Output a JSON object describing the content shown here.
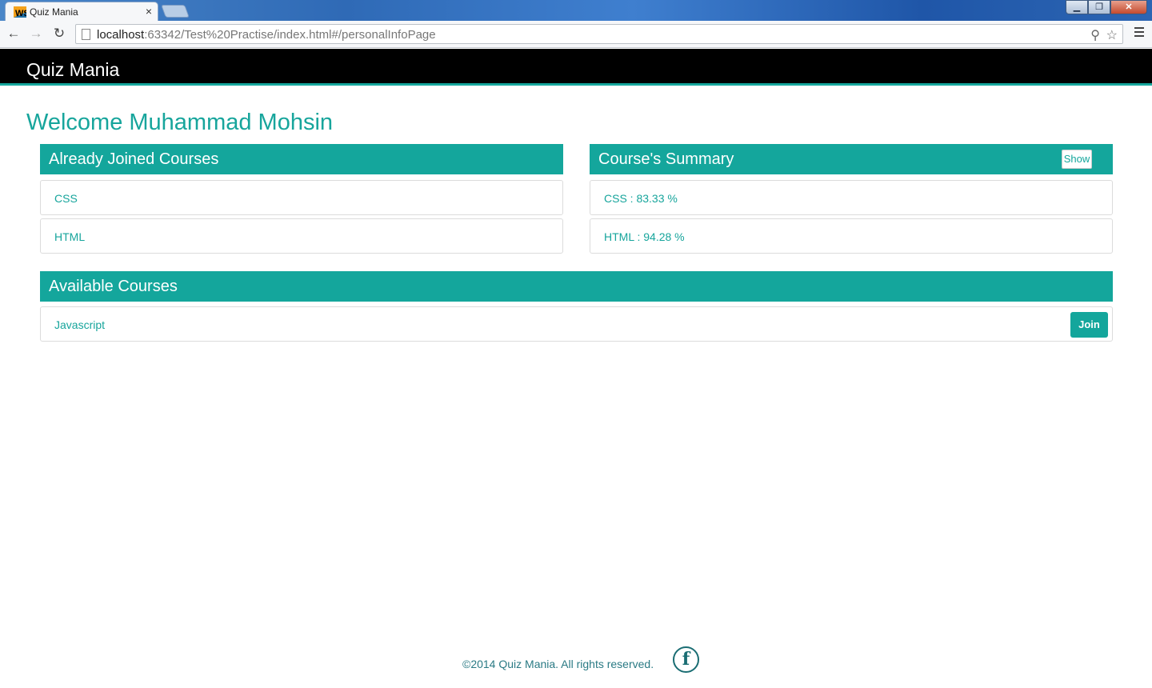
{
  "browser": {
    "tab_title": "Quiz Mania",
    "tab_close": "×",
    "url_host": "localhost",
    "url_rest": ":63342/Test%20Practise/index.html#/personalInfoPage",
    "window_buttons": [
      "▁",
      "❐",
      "✕"
    ]
  },
  "navbar": {
    "brand": "Quiz Mania"
  },
  "welcome": "Welcome Muhammad Mohsin",
  "joined": {
    "title": "Already Joined Courses",
    "items": [
      "CSS",
      "HTML"
    ]
  },
  "summary": {
    "title": "Course's Summary",
    "show_label": "Show",
    "items": [
      "CSS : 83.33 %",
      "HTML : 94.28 %"
    ]
  },
  "available": {
    "title": "Available Courses",
    "items": [
      {
        "name": "Javascript",
        "action": "Join"
      }
    ]
  },
  "footer": {
    "text": "©2014 Quiz Mania. All rights reserved.",
    "facebook_glyph": "f"
  },
  "colors": {
    "accent": "#14a69c",
    "navbar": "#000000"
  }
}
